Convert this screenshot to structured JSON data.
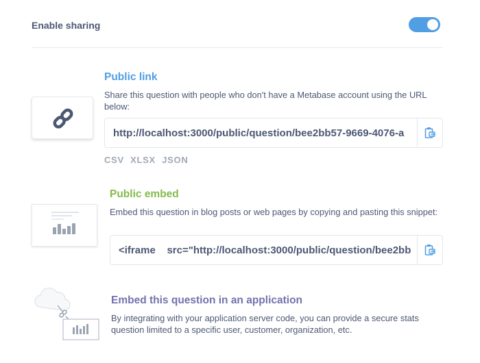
{
  "header": {
    "title": "Enable sharing",
    "toggle_on": true
  },
  "public_link": {
    "title": "Public link",
    "description": "Share this question with people who don't have a Metabase account using the URL below:",
    "url": "http://localhost:3000/public/question/bee2bb57-9669-4076-a",
    "formats": [
      "CSV",
      "XLSX",
      "JSON"
    ]
  },
  "public_embed": {
    "title": "Public embed",
    "description": "Embed this question in blog posts or web pages by copying and pasting this snippet:",
    "snippet": "<iframe    src=\"http://localhost:3000/public/question/bee2bb"
  },
  "app_embed": {
    "title": "Embed this question in an application",
    "description": "By integrating with your application server code, you can provide a secure stats question limited to a specific user, customer, organization, etc."
  },
  "colors": {
    "toggle": "#509ee3",
    "public_link_title": "#509ee3",
    "public_embed_title": "#84bb4c",
    "app_embed_title": "#7172ad",
    "text": "#4c5773",
    "copy_icon": "#509ee3"
  },
  "icons": [
    "link-icon",
    "copy-icon",
    "embed-preview-icon",
    "cloud-icon",
    "chart-icon"
  ]
}
